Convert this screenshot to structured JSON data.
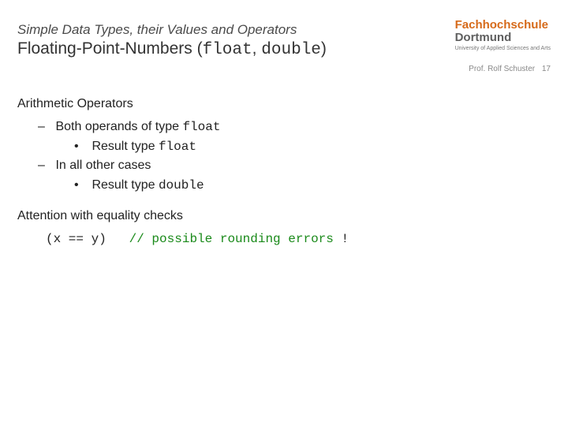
{
  "header": {
    "supertitle": "Simple Data Types, their Values and Operators",
    "title_pre": "Floating-Point-Numbers (",
    "title_code1": "float",
    "title_sep": ", ",
    "title_code2": "double",
    "title_post": ")"
  },
  "logo": {
    "line1": "Fachhochschule",
    "line2": "Dortmund",
    "sub": "University of Applied Sciences and Arts"
  },
  "meta": {
    "author": "Prof. Rolf Schuster",
    "page": "17"
  },
  "body": {
    "sec1": "Arithmetic Operators",
    "b1_pre": "Both operands of type ",
    "b1_code": "float",
    "b1a_pre": "Result type ",
    "b1a_code": "float",
    "b2": "In all other cases",
    "b2a_pre": "Result type ",
    "b2a_code": "double",
    "sec2": "Attention with equality checks",
    "code": "(x == y)",
    "gap": "   ",
    "comment": "// possible rounding errors",
    "bang": " !"
  }
}
